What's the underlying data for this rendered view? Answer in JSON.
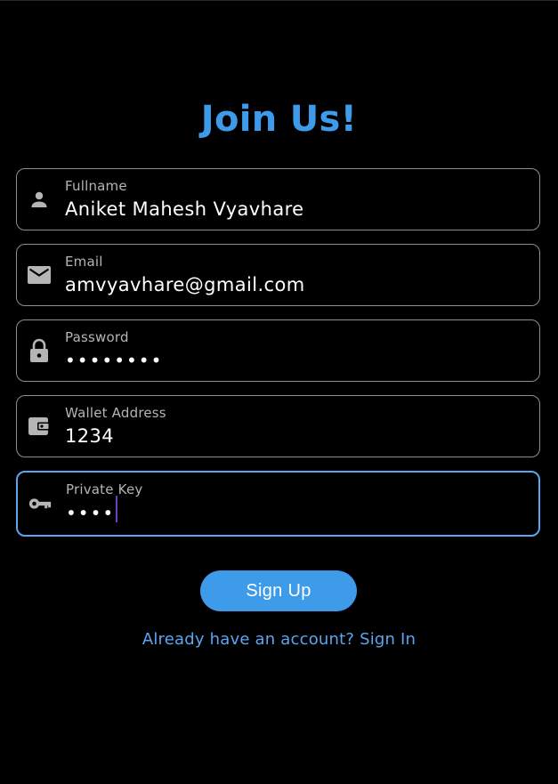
{
  "header": {
    "title": "Join Us!"
  },
  "form": {
    "fields": [
      {
        "label": "Fullname",
        "value": "Aniket Mahesh Vyavhare",
        "icon": "person-icon"
      },
      {
        "label": "Email",
        "value": "amvyavhare@gmail.com",
        "icon": "mail-icon"
      },
      {
        "label": "Password",
        "value": "••••••••",
        "icon": "lock-icon"
      },
      {
        "label": "Wallet Address",
        "value": "1234",
        "icon": "wallet-icon"
      },
      {
        "label": "Private Key",
        "value": "••••",
        "icon": "key-icon",
        "focused": true
      }
    ],
    "submit_label": "Sign Up",
    "signin_link": "Already have an account? Sign In"
  },
  "colors": {
    "accent": "#3d9be9",
    "link": "#5aa6f0",
    "background": "#000000",
    "field_border": "#8e8e8e",
    "icon": "#b5b5b5",
    "caret": "#6b3fc4"
  }
}
